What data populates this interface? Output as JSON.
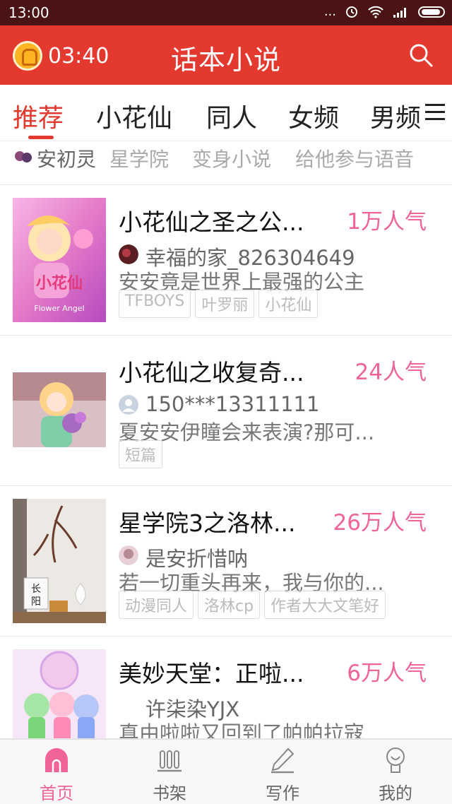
{
  "status_bar": {
    "time": "13:00",
    "indicators": "...",
    "icons": [
      "alarm-icon",
      "wifi-icon",
      "signal-icon",
      "battery-icon"
    ]
  },
  "header": {
    "timer": "03:40",
    "title": "话本小说",
    "accent_color": "#e3392e",
    "icons": [
      "clock-coin-icon",
      "search-icon"
    ]
  },
  "tabs": [
    {
      "label": "推荐",
      "active": true
    },
    {
      "label": "小花仙",
      "active": false
    },
    {
      "label": "同人",
      "active": false
    },
    {
      "label": "女频",
      "active": false
    },
    {
      "label": "男频",
      "active": false
    }
  ],
  "ticker": [
    "安初灵",
    "星学院",
    "变身小说",
    "给他参与语音"
  ],
  "novels": [
    {
      "title": "小花仙之圣之公...",
      "popularity": "1万人气",
      "author": "幸福的家_826304649",
      "summary": "安安竟是世界上最强的公主",
      "tags": [
        "TFBOYS",
        "叶罗丽",
        "小花仙"
      ],
      "cover_text": [
        "小花仙",
        "Flower Angel"
      ]
    },
    {
      "title": "小花仙之收复奇...",
      "popularity": "24人气",
      "author": "150***13311111",
      "summary": "夏安安伊瞳会来表演?那可...",
      "tags": [
        "短篇"
      ],
      "cover_text": []
    },
    {
      "title": "星学院3之洛林...",
      "popularity": "26万人气",
      "author": "是安折惜呐",
      "summary": "若一切重头再来，我与你的...",
      "tags": [
        "动漫同人",
        "洛林cp",
        "作者大大文笔好"
      ],
      "cover_text": [
        "长",
        "阳"
      ]
    },
    {
      "title": "美妙天堂：正啦...",
      "popularity": "6万人气",
      "author": "许柒染YJX",
      "summary": "真由啦啦又回到了帕帕拉寇",
      "tags": [],
      "cover_text": []
    }
  ],
  "bottom_nav": [
    {
      "label": "首页",
      "icon": "home-icon",
      "active": true
    },
    {
      "label": "书架",
      "icon": "bookshelf-icon",
      "active": false
    },
    {
      "label": "写作",
      "icon": "pen-icon",
      "active": false
    },
    {
      "label": "我的",
      "icon": "profile-icon",
      "active": false
    }
  ],
  "colors": {
    "primary": "#e3392e",
    "popularity": "#f06499",
    "status_bar": "#4a1414"
  }
}
